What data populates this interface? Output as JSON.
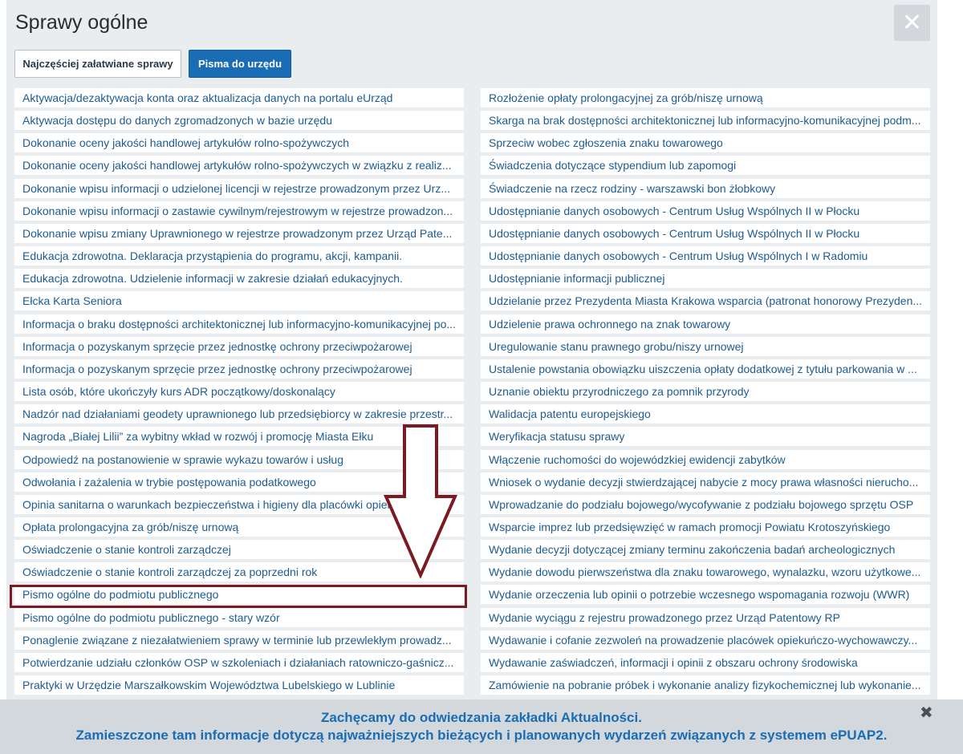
{
  "header": {
    "title": "Sprawy ogólne",
    "close_icon": "✕"
  },
  "tabs": [
    {
      "label": "Najczęściej załatwiane sprawy",
      "active": false
    },
    {
      "label": "Pisma do urzędu",
      "active": true
    }
  ],
  "list_left": [
    "Aktywacja/dezaktywacja konta oraz aktualizacja danych na portalu eUrząd",
    "Aktywacja dostępu do danych zgromadzonych w bazie urzędu",
    "Dokonanie oceny jakości handlowej artykułów rolno-spożywczych",
    "Dokonanie oceny jakości handlowej artykułów rolno-spożywczych w związku z realiz...",
    "Dokonanie wpisu informacji o udzielonej licencji w rejestrze prowadzonym przez Urz...",
    "Dokonanie wpisu informacji o zastawie cywilnym/rejestrowym w rejestrze prowadzon...",
    "Dokonanie wpisu zmiany Uprawnionego w rejestrze prowadzonym przez Urząd Pate...",
    "Edukacja zdrowotna. Deklaracja przystąpienia do programu, akcji, kampanii.",
    "Edukacja zdrowotna. Udzielenie informacji w zakresie działań edukacyjnych.",
    "Ełcka Karta Seniora",
    "Informacja o braku dostępności architektonicznej lub informacyjno-komunikacyjnej po...",
    "Informacja o pozyskanym sprzęcie przez jednostkę ochrony przeciwpożarowej",
    "Informacja o pozyskanym sprzęcie przez jednostkę ochrony przeciwpożarowej",
    "Lista osób, które ukończyły kurs ADR początkowy/doskonalący",
    "Nadzór nad działaniami geodety uprawnionego lub przedsiębiorcy w zakresie przestr...",
    "Nagroda „Białej Lilii” za wybitny wkład w rozwój i promocję Miasta Ełku",
    "Odpowiedź na postanowienie w sprawie wykazu towarów i usług",
    "Odwołania i zażalenia w trybie postępowania podatkowego",
    "Opinia sanitarna o warunkach bezpieczeństwa i higieny dla placówki opiek...",
    "Opłata prolongacyjna za grób/niszę urnową",
    "Oświadczenie o stanie kontroli zarządczej",
    "Oświadczenie o stanie kontroli zarządczej za poprzedni rok",
    "Pismo ogólne do podmiotu publicznego",
    "Pismo ogólne do podmiotu publicznego - stary wzór",
    "Ponaglenie związane z niezałatwieniem sprawy w terminie lub przewlekłym prowadz...",
    "Potwierdzanie udziału członków OSP w szkoleniach i działaniach ratowniczo-gaśnicz...",
    "Praktyki w Urzędzie Marszałkowskim Województwa Lubelskiego w Lublinie"
  ],
  "list_right": [
    "Rozłożenie opłaty prolongacyjnej za grób/niszę urnową",
    "Skarga na brak dostępności architektonicznej lub informacyjno-komunikacyjnej podm...",
    "Sprzeciw wobec zgłoszenia znaku towarowego",
    "Świadczenia dotyczące stypendium lub zapomogi",
    "Świadczenie na rzecz rodziny - warszawski bon żłobkowy",
    "Udostępnianie danych osobowych - Centrum Usług Wspólnych II w Płocku",
    "Udostępnianie danych osobowych - Centrum Usług Wspólnych II w Płocku",
    "Udostępnianie danych osobowych - Centrum Usług Wspólnych I w Radomiu",
    "Udostępnianie informacji publicznej",
    "Udzielanie przez Prezydenta Miasta Krakowa wsparcia (patronat honorowy Prezyden...",
    "Udzielenie prawa ochronnego na znak towarowy",
    "Uregulowanie stanu prawnego grobu/niszy urnowej",
    "Ustalenie powstania obowiązku uiszczenia opłaty dodatkowej z tytułu parkowania w ...",
    "Uznanie obiektu przyrodniczego za pomnik przyrody",
    "Walidacja patentu europejskiego",
    "Weryfikacja statusu sprawy",
    "Włączenie ruchomości do wojewódzkiej ewidencji zabytków",
    "Wniosek o wydanie decyzji stwierdzającej nabycie z mocy prawa własności nierucho...",
    "Wprowadzanie do podziału bojowego/wycofywanie z podziału bojowego sprzętu OSP",
    "Wsparcie imprez lub przedsięwzięć w ramach promocji Powiatu Krotoszyńskiego",
    "Wydanie decyzji dotyczącej zmiany terminu zakończenia badań archeologicznych",
    "Wydanie dowodu pierwszeństwa dla znaku towarowego, wynalazku, wzoru użytkowe...",
    "Wydanie orzeczenia lub opinii o potrzebie wczesnego wspomagania rozwoju (WWR)",
    "Wydanie wyciągu z rejestru prowadzonego przez Urząd Patentowy RP",
    "Wydawanie i cofanie zezwoleń na prowadzenie placówek opiekuńczo-wychowawczy...",
    "Wydawanie zaświadczeń, informacji i opinii z obszaru ochrony środowiska",
    "Zamówienie na pobranie próbek i wykonanie analizy fizykochemicznej lub wykonanie..."
  ],
  "banner": {
    "line1": "Zachęcamy do odwiedzania zakładki Aktualności.",
    "line2": "Zamieszczone tam informacje dotyczą najważniejszych bieżących i planowanych wydarzeń związanych z systemem ePUAP2.",
    "close_icon": "✖"
  },
  "highlight_item": "Pismo ogólne do podmiotu publicznego",
  "colors": {
    "accent": "#1a6db5",
    "link": "#1d5b93",
    "annotation": "#7b1a22",
    "panel_bg": "#eaedf0"
  },
  "icons": {
    "close": "close-icon",
    "banner_close": "close-icon",
    "annotation_arrow": "down-arrow-icon"
  }
}
